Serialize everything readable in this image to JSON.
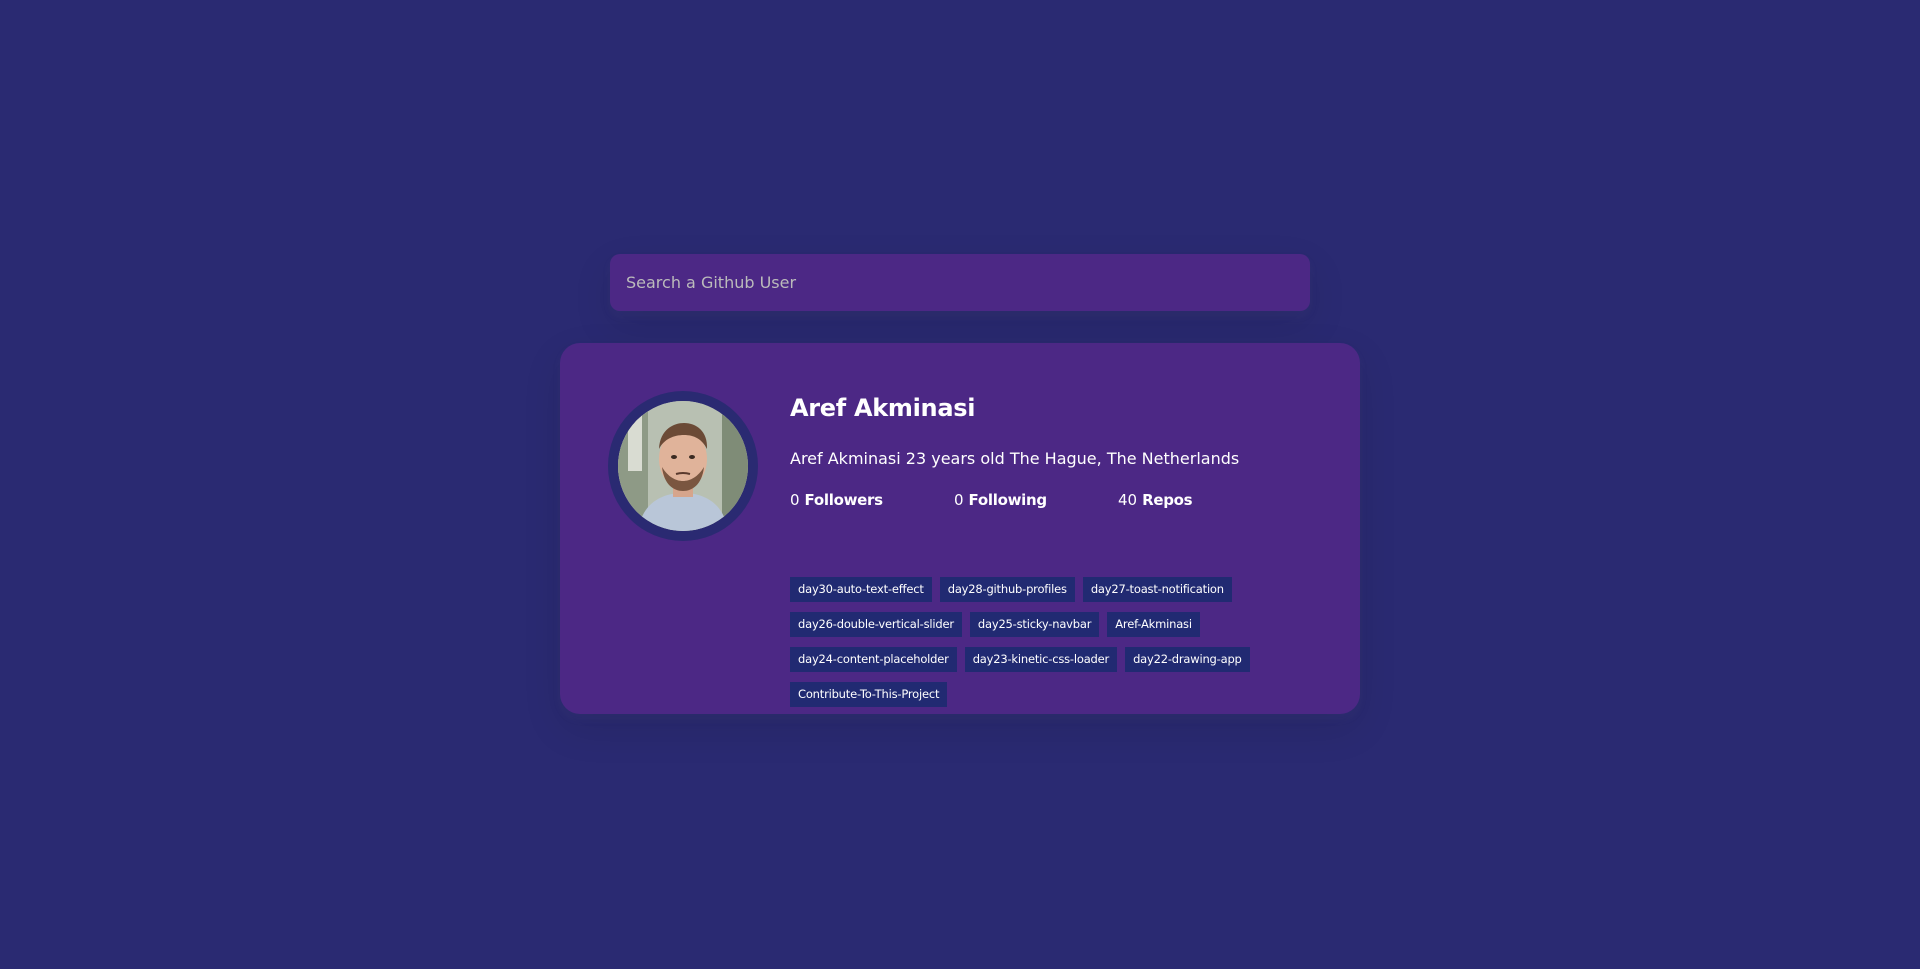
{
  "search": {
    "placeholder": "Search a Github User",
    "value": ""
  },
  "user": {
    "name": "Aref Akminasi",
    "bio": "Aref Akminasi 23 years old The Hague, The Netherlands",
    "avatar_alt": "avatar-photo"
  },
  "stats": [
    {
      "value": "0",
      "label": "Followers"
    },
    {
      "value": "0",
      "label": "Following"
    },
    {
      "value": "40",
      "label": "Repos"
    }
  ],
  "repos": [
    {
      "name": "day30-auto-text-effect"
    },
    {
      "name": "day28-github-profiles"
    },
    {
      "name": "day27-toast-notification"
    },
    {
      "name": "day26-double-vertical-slider"
    },
    {
      "name": "day25-sticky-navbar"
    },
    {
      "name": "Aref-Akminasi"
    },
    {
      "name": "day24-content-placeholder"
    },
    {
      "name": "day23-kinetic-css-loader"
    },
    {
      "name": "day22-drawing-app"
    },
    {
      "name": "Contribute-To-This-Project"
    }
  ],
  "colors": {
    "background": "#2a2a72",
    "card": "#4c2885",
    "repo_tag": "#212a72",
    "text": "#ffffff",
    "placeholder": "#bbbbbb"
  }
}
